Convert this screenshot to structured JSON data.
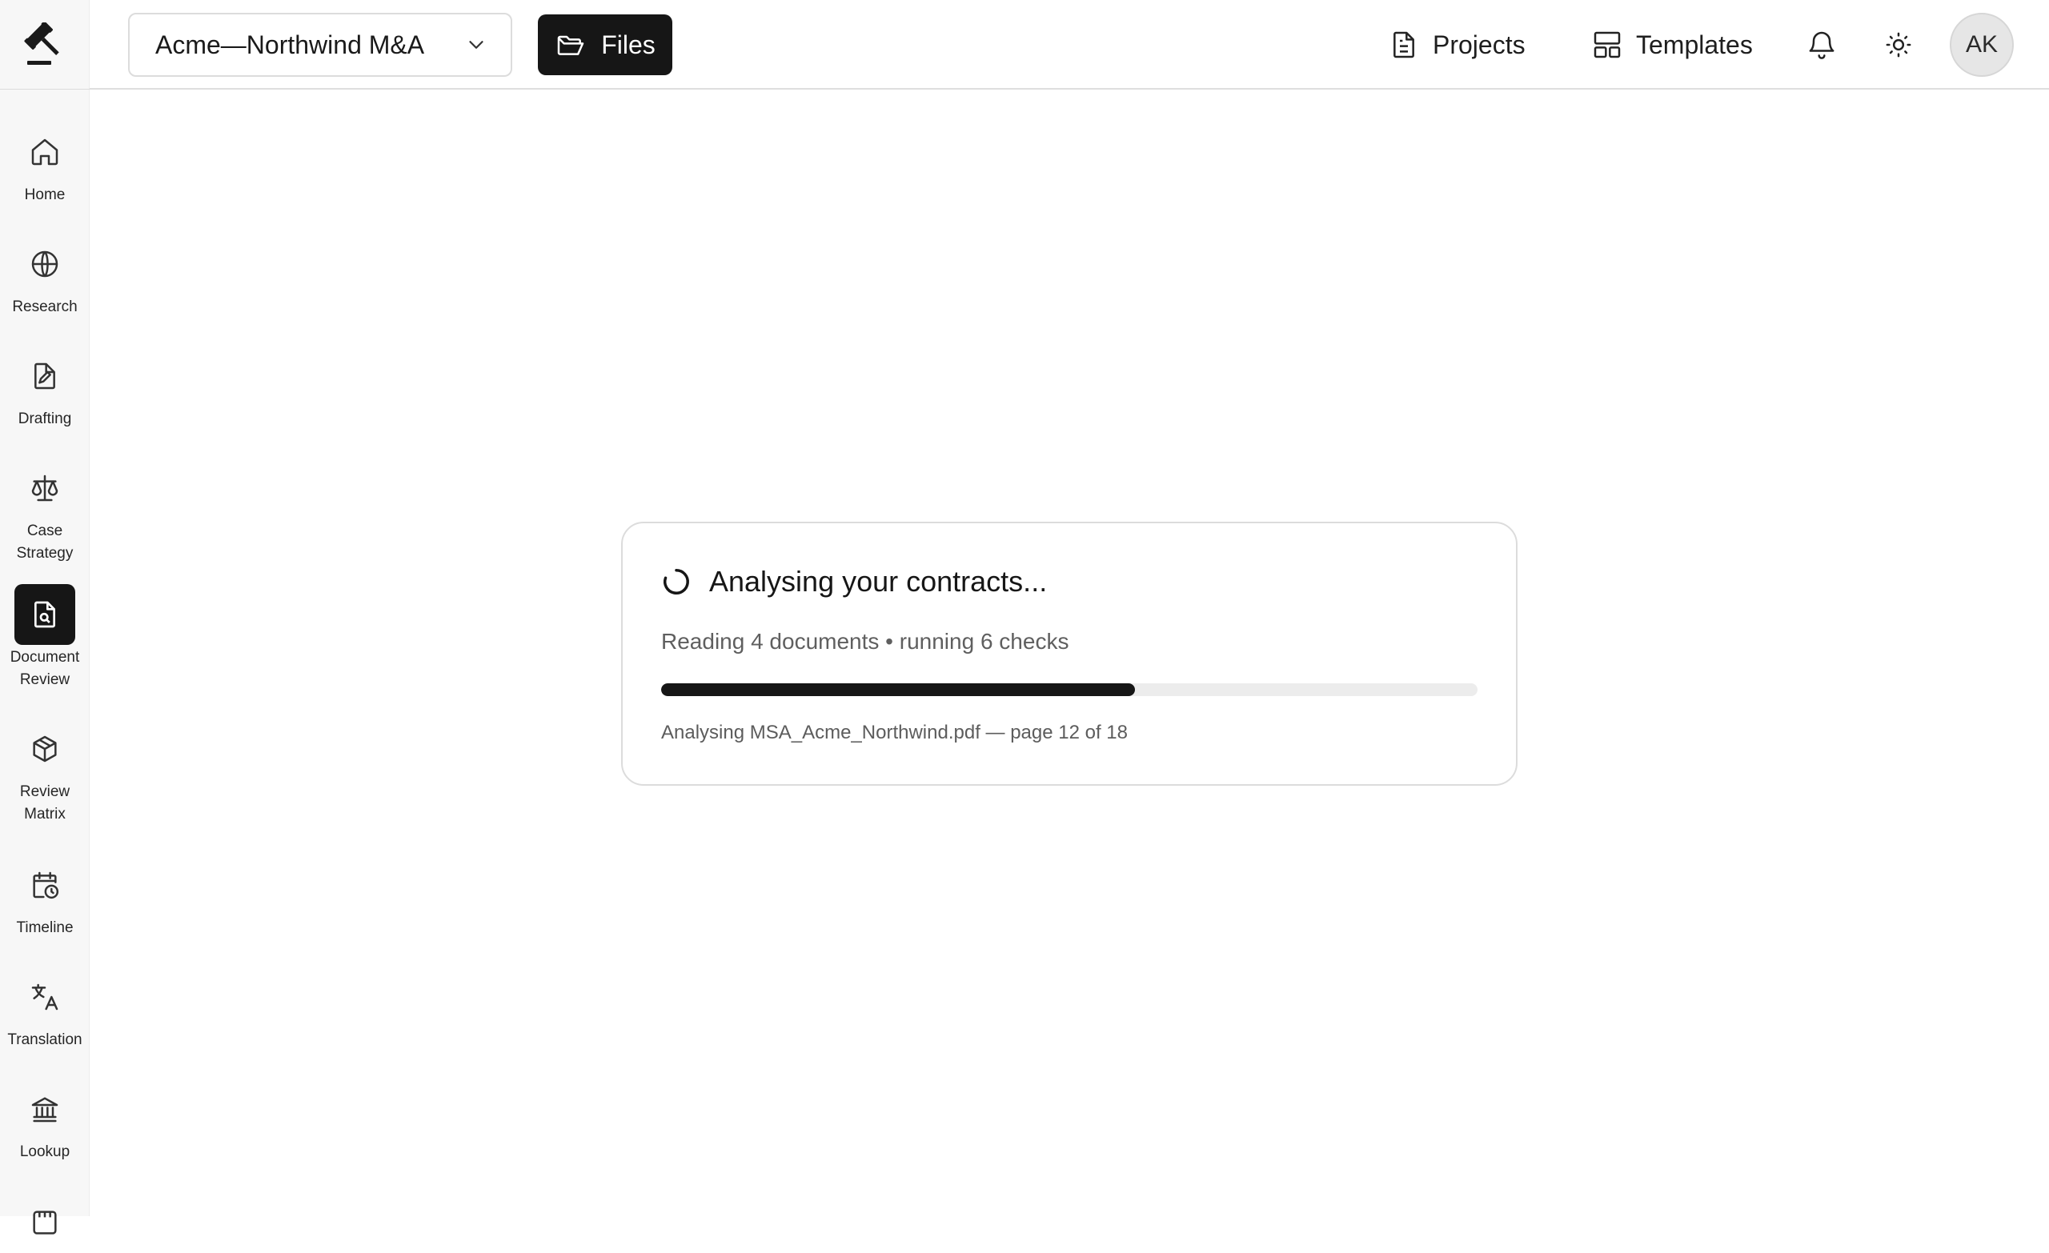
{
  "topbar": {
    "project_value": "Acme—Northwind M&A",
    "files_label": "Files",
    "projects_label": "Projects",
    "templates_label": "Templates",
    "avatar_initials": "AK"
  },
  "sidebar": {
    "items": [
      {
        "label": "Home",
        "icon": "home-icon"
      },
      {
        "label": "Research",
        "icon": "globe-icon"
      },
      {
        "label": "Drafting",
        "icon": "file-pen-icon"
      },
      {
        "label": "Case\nStrategy",
        "icon": "scales-icon"
      },
      {
        "label": "Document\nReview",
        "icon": "file-search-icon",
        "active": true
      },
      {
        "label": "Review\nMatrix",
        "icon": "package-icon"
      },
      {
        "label": "Timeline",
        "icon": "calendar-clock-icon"
      },
      {
        "label": "Translation",
        "icon": "languages-icon"
      },
      {
        "label": "Lookup",
        "icon": "landmark-icon"
      }
    ]
  },
  "progress_card": {
    "title": "Analysing your contracts...",
    "subtitle": "Reading 4 documents • running 6 checks",
    "progress_percent": 58,
    "status": "Analysing MSA_Acme_Northwind.pdf — page 12 of 18"
  },
  "colors": {
    "accent": "#161616",
    "track": "#ececec",
    "sidebar_bg": "#f7f7f7"
  }
}
